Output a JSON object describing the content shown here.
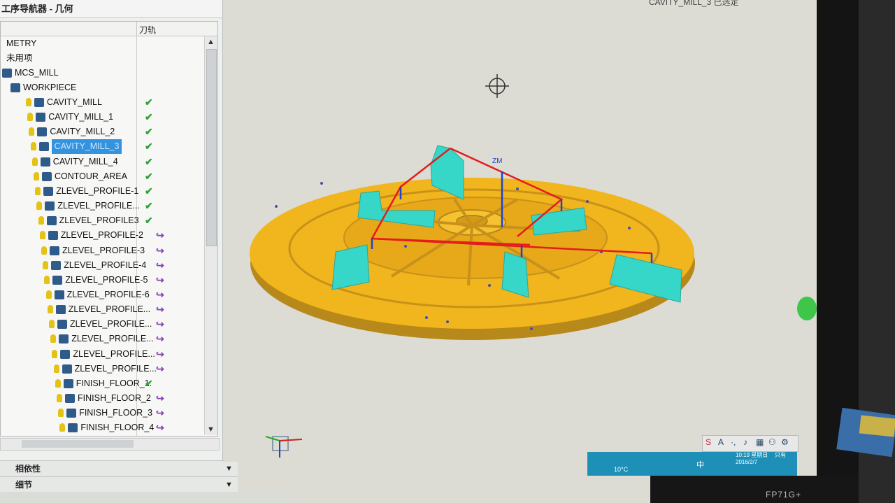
{
  "navigator": {
    "title": "工序导航器 - 几何",
    "col_toolpath": "刀轨",
    "rows": [
      {
        "label": "METRY",
        "status": ""
      },
      {
        "label": "未用项",
        "status": ""
      },
      {
        "label": "MCS_MILL",
        "status": ""
      },
      {
        "label": "WORKPIECE",
        "status": ""
      },
      {
        "label": "CAVITY_MILL",
        "status": "check"
      },
      {
        "label": "CAVITY_MILL_1",
        "status": "check"
      },
      {
        "label": "CAVITY_MILL_2",
        "status": "check"
      },
      {
        "label": "CAVITY_MILL_3",
        "status": "check"
      },
      {
        "label": "CAVITY_MILL_4",
        "status": "check"
      },
      {
        "label": "CONTOUR_AREA",
        "status": "check"
      },
      {
        "label": "ZLEVEL_PROFILE-1",
        "status": "check"
      },
      {
        "label": "ZLEVEL_PROFILE...",
        "status": "check"
      },
      {
        "label": "ZLEVEL_PROFILE3",
        "status": "check"
      },
      {
        "label": "ZLEVEL_PROFILE-2",
        "status": "regen"
      },
      {
        "label": "ZLEVEL_PROFILE-3",
        "status": "regen"
      },
      {
        "label": "ZLEVEL_PROFILE-4",
        "status": "regen"
      },
      {
        "label": "ZLEVEL_PROFILE-5",
        "status": "regen"
      },
      {
        "label": "ZLEVEL_PROFILE-6",
        "status": "regen"
      },
      {
        "label": "ZLEVEL_PROFILE...",
        "status": "regen"
      },
      {
        "label": "ZLEVEL_PROFILE...",
        "status": "regen"
      },
      {
        "label": "ZLEVEL_PROFILE...",
        "status": "regen"
      },
      {
        "label": "ZLEVEL_PROFILE...",
        "status": "regen"
      },
      {
        "label": "ZLEVEL_PROFILE...",
        "status": "regen"
      },
      {
        "label": "FINISH_FLOOR_1:",
        "status": "check"
      },
      {
        "label": "FINISH_FLOOR_2",
        "status": "regen"
      },
      {
        "label": "FINISH_FLOOR_3",
        "status": "regen"
      },
      {
        "label": "FINISH_FLOOR_4",
        "status": "regen"
      }
    ],
    "selected_index": 7,
    "panel_dependencies": "相依性",
    "panel_details": "细节"
  },
  "viewport": {
    "title": "CAVITY_MILL_3 已选定",
    "axis_label": "ZM"
  },
  "taskbar": {
    "temperature": "10°C",
    "ime_lang": "中",
    "time": "10:19 星期日",
    "date": "2016/2/7",
    "ime_mode": "只有"
  },
  "monitor": {
    "brand": "FP71G+"
  },
  "colors": {
    "part": "#f2b51c",
    "clamp": "#36d6c8",
    "path": "#e41c1c",
    "selection": "#3393df",
    "check": "#2fa33a",
    "regen": "#8a3fb8"
  }
}
